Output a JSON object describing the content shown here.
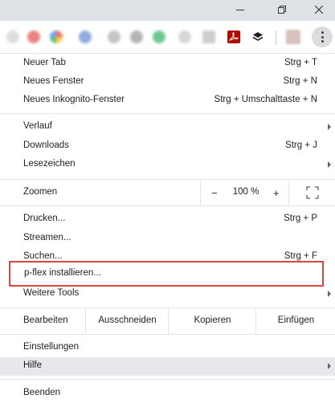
{
  "window_controls": {
    "minimize_icon": "minimize-icon",
    "maximize_icon": "restore-icon",
    "close_icon": "close-icon"
  },
  "toolbar": {
    "extension_icons": [
      "extension-icon-red",
      "extension-icon-multicolor",
      "extension-icon-blue",
      "extension-icon-gray",
      "extension-icon-green",
      "extension-icon-gray",
      "extension-icon-arrow",
      "adobe-pdf-icon",
      "layers-icon"
    ],
    "menu_icon": "three-dots-vertical-icon"
  },
  "menu": {
    "group1": [
      {
        "label": "Neuer Tab",
        "shortcut": "Strg + T"
      },
      {
        "label": "Neues Fenster",
        "shortcut": "Strg + N"
      },
      {
        "label": "Neues Inkognito-Fenster",
        "shortcut": "Strg + Umschalttaste + N"
      }
    ],
    "group2": [
      {
        "label": "Verlauf",
        "shortcut": ""
      },
      {
        "label": "Downloads",
        "shortcut": "Strg + J"
      },
      {
        "label": "Lesezeichen",
        "shortcut": ""
      }
    ],
    "zoom": {
      "label": "Zoomen",
      "minus": "−",
      "value": "100 %",
      "plus": "+",
      "fullscreen_icon": "fullscreen-icon"
    },
    "group3": [
      {
        "label": "Drucken...",
        "shortcut": "Strg + P"
      },
      {
        "label": "Streamen...",
        "shortcut": ""
      },
      {
        "label": "Suchen...",
        "shortcut": "Strg + F"
      }
    ],
    "highlighted_item": "p-flex installieren...",
    "more_tools": "Weitere Tools",
    "edit": {
      "label": "Bearbeiten",
      "cut": "Ausschneiden",
      "copy": "Kopieren",
      "paste": "Einfügen"
    },
    "settings": "Einstellungen",
    "help": "Hilfe",
    "quit": "Beenden"
  },
  "colors": {
    "highlight_border": "#e0453d",
    "hover_background": "#e8e8ec",
    "titlebar": "#dee1e6"
  }
}
